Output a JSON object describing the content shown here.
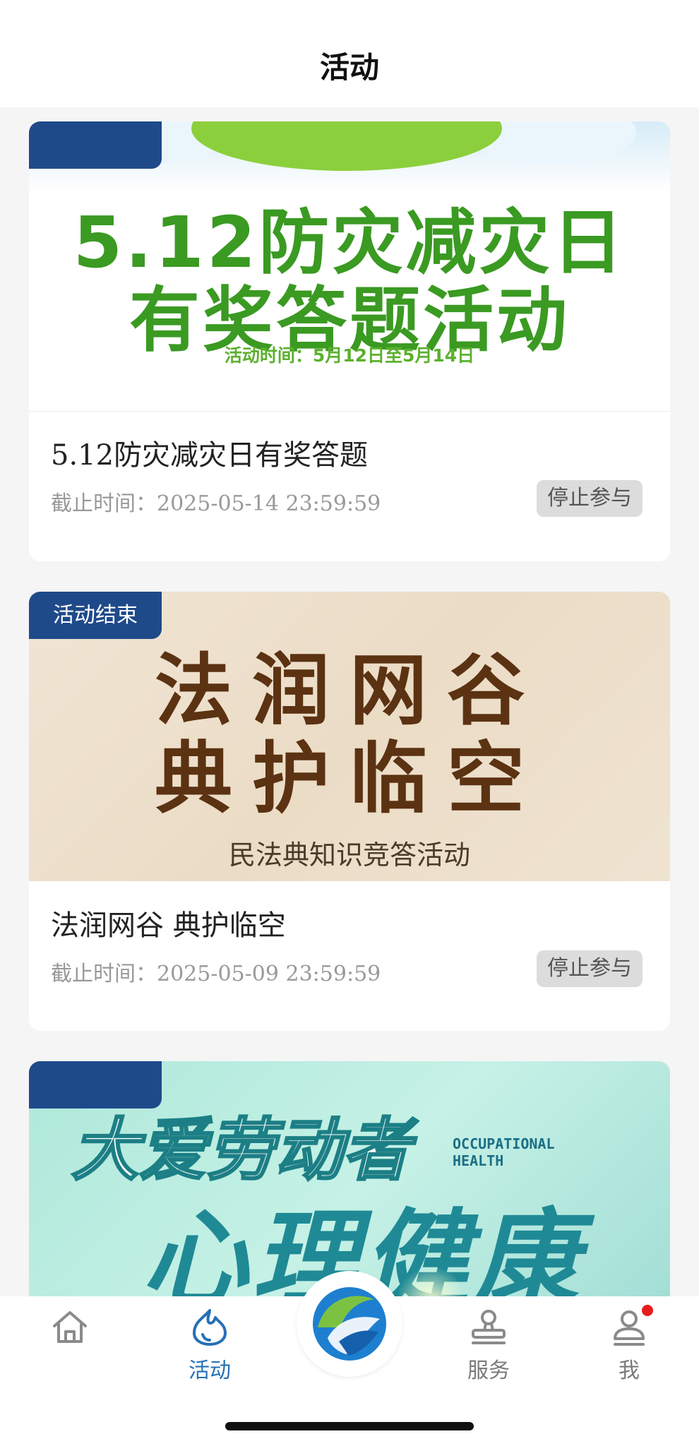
{
  "header": {
    "title": "活动"
  },
  "activities": [
    {
      "badge": "",
      "banner": {
        "line1": "5.12防灾减灾日",
        "line2": "有奖答题活动",
        "subtitle": "活动时间：5月12日至5月14日"
      },
      "title": "5.12防灾减灾日有奖答题",
      "deadline": "截止时间：2025-05-14 23:59:59",
      "status": "停止参与"
    },
    {
      "badge": "活动结束",
      "banner": {
        "line1": "法润网谷",
        "line2": "典护临空",
        "subtitle": "民法典知识竞答活动"
      },
      "title": "法润网谷 典护临空",
      "deadline": "截止时间：2025-05-09 23:59:59",
      "status": "停止参与"
    },
    {
      "badge": "",
      "banner": {
        "line1": "大爱劳动者",
        "tag": "OCCUPATIONAL HEALTH",
        "line2": "心理健康"
      }
    }
  ],
  "tabbar": {
    "items": [
      {
        "label": "",
        "icon": "home-icon"
      },
      {
        "label": "活动",
        "icon": "activity-icon",
        "active": true
      },
      {
        "label": "",
        "icon": "app-logo-icon"
      },
      {
        "label": "服务",
        "icon": "service-icon"
      },
      {
        "label": "我",
        "icon": "profile-icon",
        "notification_dot": true
      }
    ]
  },
  "colors": {
    "accent": "#2670b5",
    "badge": "#1f4a8a",
    "status_bg": "#dcdcdc",
    "notification": "#e81c1c"
  }
}
